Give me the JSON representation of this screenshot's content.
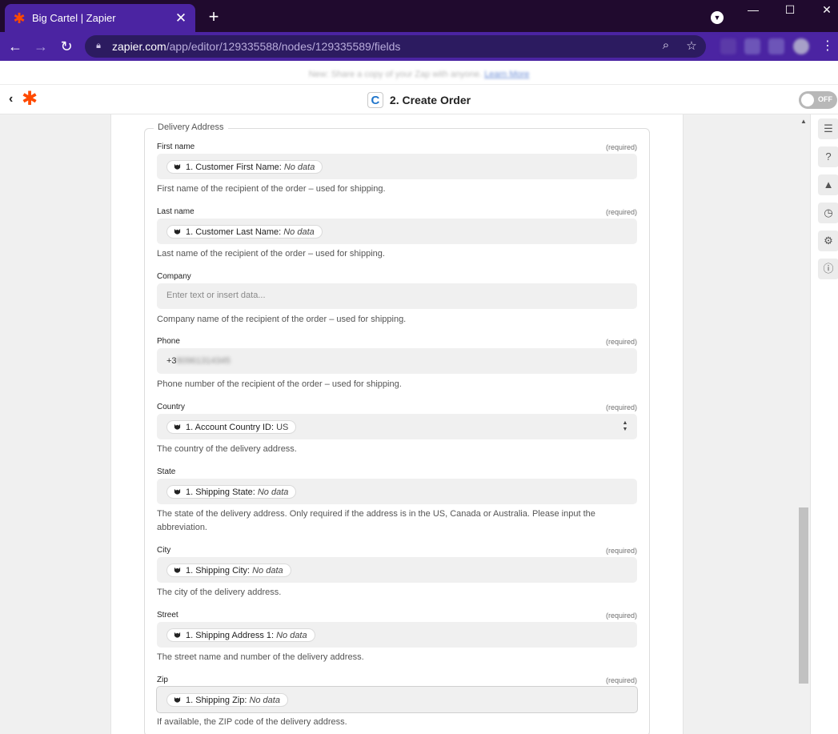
{
  "browser": {
    "tab_title": "Big Cartel | Zapier",
    "tab_close": "✕",
    "new_tab": "+",
    "url_host": "zapier.com",
    "url_path": "/app/editor/129335588/nodes/129335589/fields",
    "window_controls": [
      "—",
      "☐",
      "✕"
    ]
  },
  "banner": {
    "text": "New: Share a copy of your Zap with anyone.",
    "link": "Learn More"
  },
  "header": {
    "app_letter": "C",
    "step_title": "2. Create Order",
    "toggle_label": "OFF"
  },
  "form": {
    "legend": "Delivery Address",
    "required_text": "(required)",
    "fields": [
      {
        "label": "First name",
        "required": true,
        "pill_label": "1. Customer First Name:",
        "pill_value": "No data",
        "help": "First name of the recipient of the order – used for shipping."
      },
      {
        "label": "Last name",
        "required": true,
        "pill_label": "1. Customer Last Name:",
        "pill_value": "No data",
        "help": "Last name of the recipient of the order – used for shipping."
      },
      {
        "label": "Company",
        "required": false,
        "placeholder": "Enter text or insert data...",
        "help": "Company name of the recipient of the order – used for shipping."
      },
      {
        "label": "Phone",
        "required": true,
        "text_value": "+3",
        "text_blurred": "8096131434​5",
        "help": "Phone number of the recipient of the order – used for shipping."
      },
      {
        "label": "Country",
        "required": true,
        "pill_label": "1. Account Country ID:",
        "pill_value": "US",
        "help": "The country of the delivery address."
      },
      {
        "label": "State",
        "required": false,
        "pill_label": "1. Shipping State:",
        "pill_value": "No data",
        "help": "The state of the delivery address. Only required if the address is in the US, Canada or Australia. Please input the abbreviation."
      },
      {
        "label": "City",
        "required": true,
        "pill_label": "1. Shipping City:",
        "pill_value": "No data",
        "help": "The city of the delivery address."
      },
      {
        "label": "Street",
        "required": true,
        "pill_label": "1. Shipping Address 1:",
        "pill_value": "No data",
        "help": "The street name and number of the delivery address."
      },
      {
        "label": "Zip",
        "required": true,
        "pill_label": "1. Shipping Zip:",
        "pill_value": "No data",
        "help": "If available, the ZIP code of the delivery address."
      }
    ]
  },
  "colors": {
    "chrome_frame": "#200a2e",
    "chrome_toolbar": "#4b24a2",
    "zapier_orange": "#ff4a00",
    "app_badge_blue": "#1f75cb"
  }
}
